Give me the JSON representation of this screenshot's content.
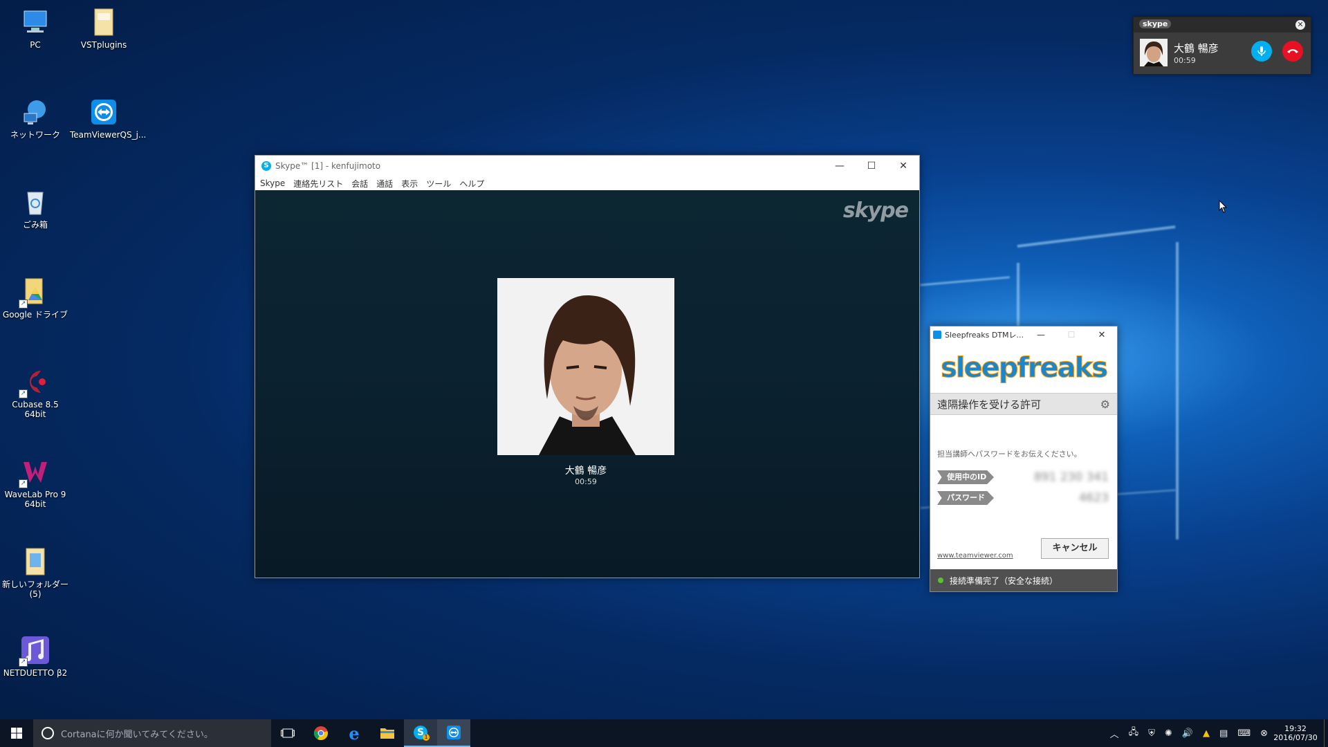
{
  "desktop_icons": [
    {
      "label": "PC",
      "icon": "pc-icon"
    },
    {
      "label": "VSTplugins",
      "icon": "folder-icon"
    },
    {
      "label": "ネットワーク",
      "icon": "network-icon"
    },
    {
      "label": "TeamViewerQS_j...",
      "icon": "teamviewer-icon"
    },
    {
      "label": "ごみ箱",
      "icon": "recycle-bin-icon"
    },
    {
      "label": "Google ドライブ",
      "icon": "google-drive-icon"
    },
    {
      "label": "Cubase 8.5 64bit",
      "icon": "cubase-icon"
    },
    {
      "label": "WaveLab Pro 9 64bit",
      "icon": "wavelab-icon"
    },
    {
      "label": "新しいフォルダー (5)",
      "icon": "folder-icon"
    },
    {
      "label": "NETDUETTO β2",
      "icon": "netduetto-icon"
    }
  ],
  "call_popup": {
    "brand": "skype",
    "caller": "大鶴 暢彦",
    "duration": "00:59"
  },
  "skype_window": {
    "title": "Skype™ [1] - kenfujimoto",
    "menu": [
      "Skype",
      "連絡先リスト",
      "会話",
      "通話",
      "表示",
      "ツール",
      "ヘルプ"
    ],
    "logo": "skype",
    "caller": "大鶴 暢彦",
    "duration": "00:59"
  },
  "teamviewer_window": {
    "title": "Sleepfreaks DTMレ...",
    "brand": "sleepfreaks",
    "section_title": "遠隔操作を受ける許可",
    "instruction": "担当講師へパスワードをお伝えください。",
    "id_label": "使用中のID",
    "password_label": "パスワード",
    "id_value": "891 230 341",
    "password_value": "4623",
    "link": "www.teamviewer.com",
    "cancel_label": "キャンセル",
    "status": "接続準備完了（安全な接続）"
  },
  "taskbar": {
    "search_placeholder": "Cortanaに何か聞いてみてください。",
    "skype_badge": "1",
    "time": "19:32",
    "date": "2016/07/30"
  },
  "colors": {
    "skype_blue": "#00aff0",
    "hangup_red": "#e81123",
    "sleepfreaks_blue": "#1a86cc",
    "sleepfreaks_orange": "#f39800",
    "status_green": "#58c232"
  }
}
